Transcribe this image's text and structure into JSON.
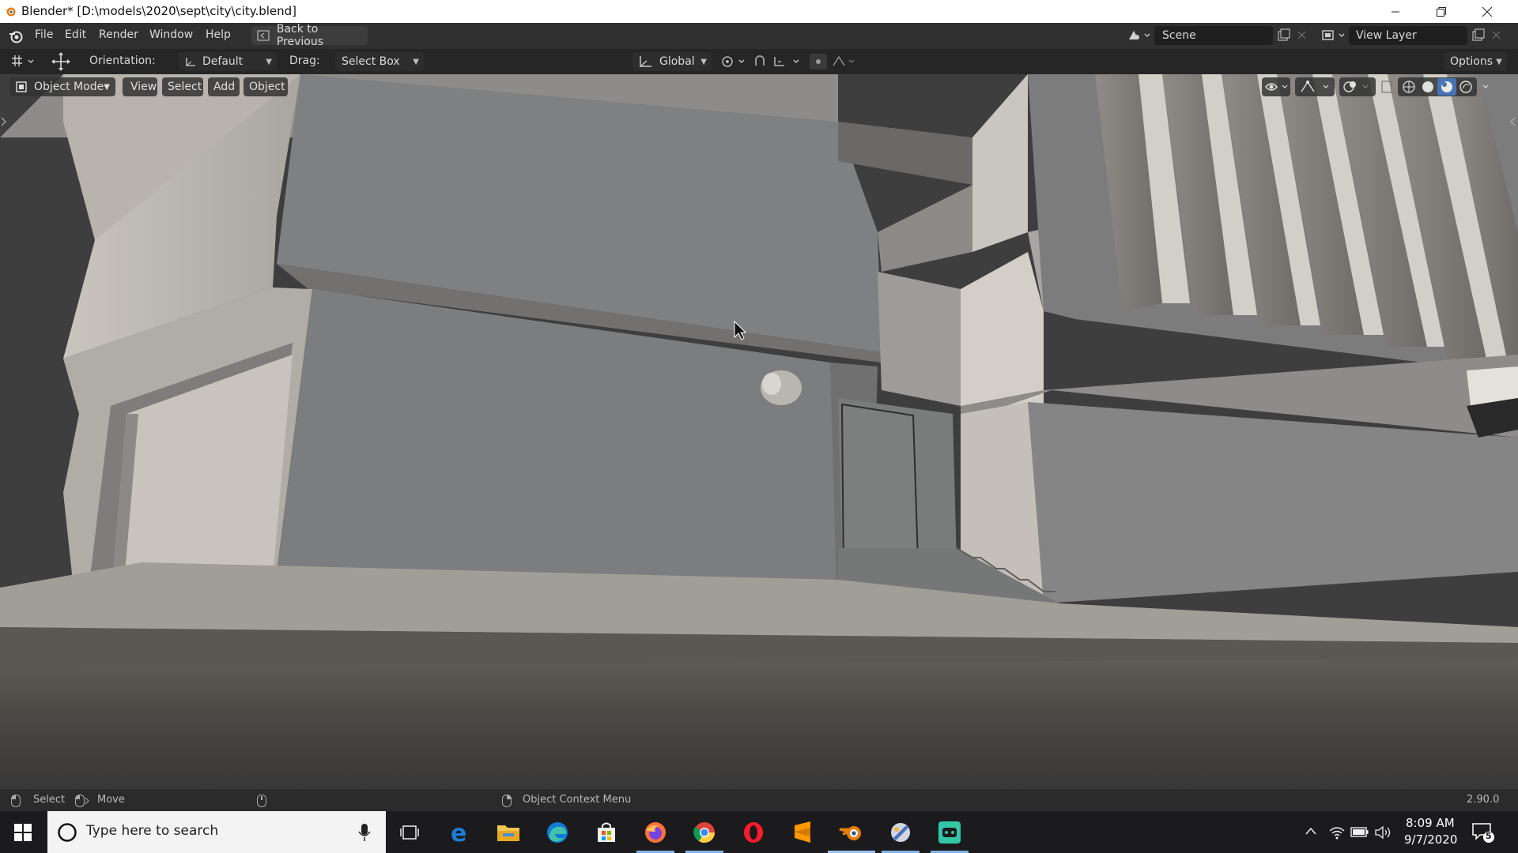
{
  "window": {
    "title": "Blender* [D:\\models\\2020\\sept\\city\\city.blend]",
    "minimize_icon": "minimize-icon",
    "restore_icon": "restore-icon",
    "close_icon": "close-icon"
  },
  "menubar": {
    "items": [
      "File",
      "Edit",
      "Render",
      "Window",
      "Help"
    ],
    "back_button": "Back to Previous",
    "scene_label": "Scene",
    "view_layer_label": "View Layer"
  },
  "tool_header": {
    "orientation_label": "Orientation:",
    "orientation_value": "Default",
    "drag_label": "Drag:",
    "drag_value": "Select Box",
    "transform_orientation": "Global",
    "options_label": "Options"
  },
  "viewport_header": {
    "mode": "Object Mode",
    "menus": [
      "View",
      "Select",
      "Add",
      "Object"
    ]
  },
  "statusbar": {
    "select": "Select",
    "move": "Move",
    "context_menu": "Object Context Menu",
    "version": "2.90.0"
  },
  "taskbar": {
    "search_placeholder": "Type here to search",
    "time": "8:09 AM",
    "date": "9/7/2020",
    "notification_count": "5",
    "apps": [
      "task-view-icon",
      "edge-legacy-icon",
      "file-explorer-icon",
      "edge-icon",
      "store-icon",
      "firefox-icon",
      "chrome-icon",
      "opera-icon",
      "sublime-icon",
      "blender-icon",
      "paint-tool-icon",
      "game-app-icon"
    ]
  },
  "colors": {
    "blender_orange": "#e87d0d",
    "accent_blue": "#4772b3",
    "taskbar_bg": "#1b1b1d"
  }
}
